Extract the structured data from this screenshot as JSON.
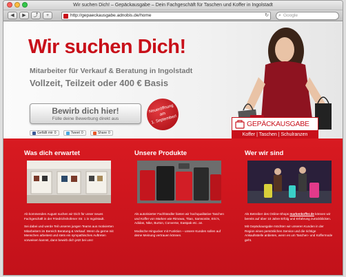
{
  "browser": {
    "title": "Wir suchen Dich! – Gepäckausgabe – Dein Fachgeschäft für Taschen und Koffer in Ingolstadt",
    "url": "http://gepaeckausgabe.adnobis.de/home",
    "search_placeholder": "Google",
    "buttons": {
      "back": "◀",
      "forward": "▶",
      "share": "⤴",
      "add": "+"
    },
    "colors": {
      "close": "#fc605b",
      "minimize": "#fdbc40",
      "zoom": "#34c84a"
    }
  },
  "hero": {
    "headline": "Wir suchen Dich!",
    "sub1": "Mitarbeiter für Verkauf & Beratung in Ingolstadt",
    "sub2": "Vollzeit, Teilzeit oder 400 € Basis",
    "apply_title": "Bewirb dich hier!",
    "apply_sub": "Fülle deine Bewerbung direkt aus",
    "badge_line1": "Neueröffnung",
    "badge_line2": "am",
    "badge_line3": "1. September!",
    "social": {
      "like": "Gefällt mir",
      "tweet": "Tweet",
      "share": "Share",
      "like_count": "0",
      "tweet_count": "0",
      "share_count": "0"
    }
  },
  "logo": {
    "word": "GEPÄCKAUSGABE",
    "tagline": "Koffer | Taschen | Schulranzen"
  },
  "columns": [
    {
      "title": "Was dich erwartet",
      "p1": "Ab kommenden August suchen wir Dich für unser neues Fachgeschäft in der Friedrichshofener Str. 1 in Ingolstadt.",
      "p2": "Sei dabei und werde Teil unseres jungen Teams aus motivierten Mitarbeitern im Bereich Beratung & Verkauf. Wenn du gerne mit Menschen arbeitest und stets ein sympathisches Auftreten vorweisen kannst, dann bewirb dich jetzt bei uns!"
    },
    {
      "title": "Unsere Produkte",
      "p1": "Als autorisierter Fachhändler bieten wir hochqualitative Taschen und Koffer von Marken wie Rimowa, Titan, Samsonite, Eric's, Adidas, Nike, Burton, Converse, Eastpak etc. an.",
      "p2": "Modische Hingucker mit Funktion – unsere Kunden sollen auf deine Meinung vertrauen können."
    },
    {
      "title": "Wer wir sind",
      "p1_pre": "Als Betreiber des Online-Shops ",
      "p1_link": "markenkoffer.de",
      "p1_post": " können wir bereits auf über 10 Jahre Erfolg und Erfahrung zurückblicken.",
      "p2": "Mit Gepäckausgabe möchten wir unseren Kunden in der Region einen persönlichen Service und die richtige Ankaufsstelle anbieten, wenn es um Taschen- und Koffermode geht."
    }
  ],
  "accent_color": "#c8101a"
}
